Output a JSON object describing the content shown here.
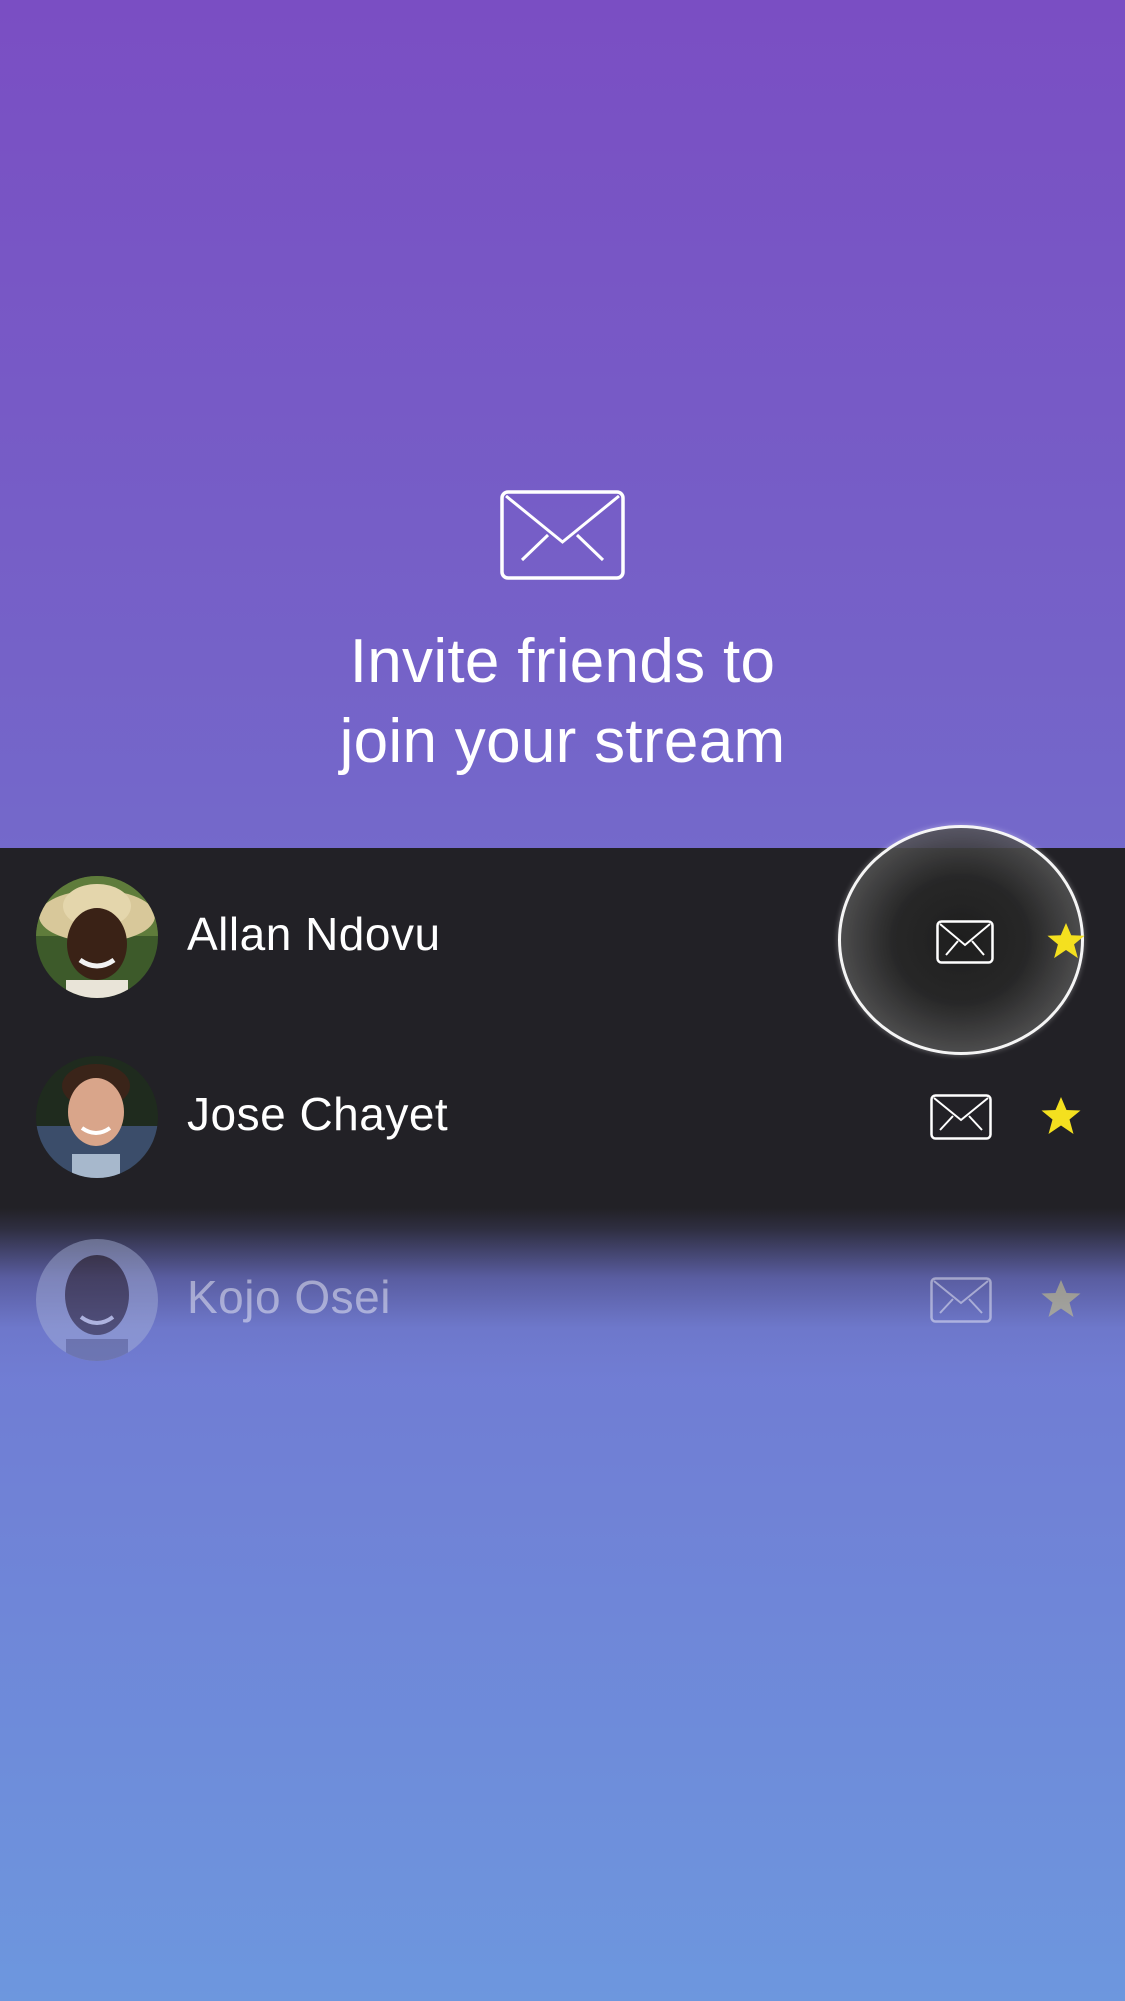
{
  "header": {
    "icon": "envelope-icon",
    "title_line1": "Invite friends to",
    "title_line2": "join your stream"
  },
  "contacts": [
    {
      "name": "Allan Ndovu",
      "invite_icon": "envelope-icon",
      "favorite_icon": "star-icon",
      "favorite": true,
      "highlighted": true
    },
    {
      "name": "Jose Chayet",
      "invite_icon": "envelope-icon",
      "favorite_icon": "star-icon",
      "favorite": true,
      "highlighted": false
    },
    {
      "name": "Kojo Osei",
      "invite_icon": "envelope-icon",
      "favorite_icon": "star-icon",
      "favorite": true,
      "highlighted": false
    }
  ],
  "colors": {
    "background_top": "#7a4ec3",
    "background_bottom": "#6d97de",
    "list_background": "#222126",
    "star": "#f4e01f",
    "text": "#ffffff"
  }
}
